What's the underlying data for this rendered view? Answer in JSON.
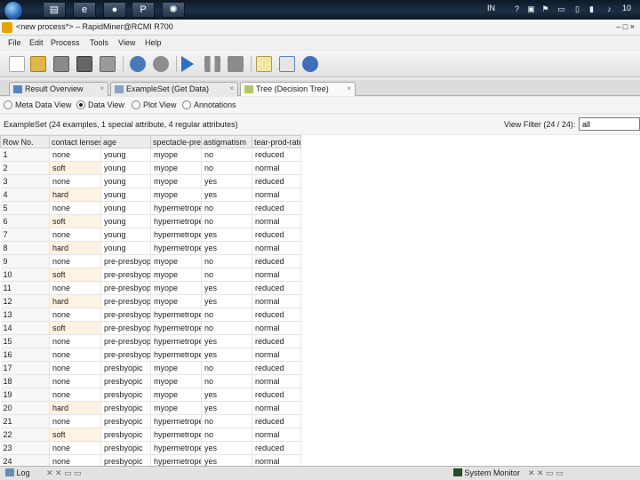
{
  "taskbar": {
    "tray": {
      "language": "IN",
      "time": "10"
    }
  },
  "window": {
    "title": "<new process*> – RapidMiner@RCMI R700",
    "controls": "– □ ×"
  },
  "menu": [
    "File",
    "Edit",
    "Process",
    "Tools",
    "View",
    "Help"
  ],
  "tabs": [
    {
      "label": "Result Overview",
      "close": "×"
    },
    {
      "label": "ExampleSet (Get Data)",
      "close": "×"
    },
    {
      "label": "Tree (Decision Tree)",
      "close": "×"
    }
  ],
  "views": [
    {
      "label": "Meta Data View",
      "selected": false
    },
    {
      "label": "Data View",
      "selected": true
    },
    {
      "label": "Plot View",
      "selected": false
    },
    {
      "label": "Annotations",
      "selected": false
    }
  ],
  "summary": "ExampleSet (24 examples, 1 special attribute, 4 regular attributes)",
  "filter": {
    "label": "View Filter (24 / 24):",
    "value": "all"
  },
  "table": {
    "columns": [
      "Row No.",
      "contact lenses",
      "age",
      "spectacle-prescrip",
      "astigmatism",
      "tear-prod-rate"
    ],
    "rows": [
      [
        "1",
        "none",
        "young",
        "myope",
        "no",
        "reduced"
      ],
      [
        "2",
        "soft",
        "young",
        "myope",
        "no",
        "normal"
      ],
      [
        "3",
        "none",
        "young",
        "myope",
        "yes",
        "reduced"
      ],
      [
        "4",
        "hard",
        "young",
        "myope",
        "yes",
        "normal"
      ],
      [
        "5",
        "none",
        "young",
        "hypermetrope",
        "no",
        "reduced"
      ],
      [
        "6",
        "soft",
        "young",
        "hypermetrope",
        "no",
        "normal"
      ],
      [
        "7",
        "none",
        "young",
        "hypermetrope",
        "yes",
        "reduced"
      ],
      [
        "8",
        "hard",
        "young",
        "hypermetrope",
        "yes",
        "normal"
      ],
      [
        "9",
        "none",
        "pre-presbyopic",
        "myope",
        "no",
        "reduced"
      ],
      [
        "10",
        "soft",
        "pre-presbyopic",
        "myope",
        "no",
        "normal"
      ],
      [
        "11",
        "none",
        "pre-presbyopic",
        "myope",
        "yes",
        "reduced"
      ],
      [
        "12",
        "hard",
        "pre-presbyopic",
        "myope",
        "yes",
        "normal"
      ],
      [
        "13",
        "none",
        "pre-presbyopic",
        "hypermetrope",
        "no",
        "reduced"
      ],
      [
        "14",
        "soft",
        "pre-presbyopic",
        "hypermetrope",
        "no",
        "normal"
      ],
      [
        "15",
        "none",
        "pre-presbyopic",
        "hypermetrope",
        "yes",
        "reduced"
      ],
      [
        "16",
        "none",
        "pre-presbyopic",
        "hypermetrope",
        "yes",
        "normal"
      ],
      [
        "17",
        "none",
        "presbyopic",
        "myope",
        "no",
        "reduced"
      ],
      [
        "18",
        "none",
        "presbyopic",
        "myope",
        "no",
        "normal"
      ],
      [
        "19",
        "none",
        "presbyopic",
        "myope",
        "yes",
        "reduced"
      ],
      [
        "20",
        "hard",
        "presbyopic",
        "myope",
        "yes",
        "normal"
      ],
      [
        "21",
        "none",
        "presbyopic",
        "hypermetrope",
        "no",
        "reduced"
      ],
      [
        "22",
        "soft",
        "presbyopic",
        "hypermetrope",
        "no",
        "normal"
      ],
      [
        "23",
        "none",
        "presbyopic",
        "hypermetrope",
        "yes",
        "reduced"
      ],
      [
        "24",
        "none",
        "presbyopic",
        "hypermetrope",
        "yes",
        "normal"
      ]
    ]
  },
  "statusbar": {
    "log_tab": "Log",
    "system_monitor_tab": "System Monitor"
  },
  "colors": {
    "label_cell": "#fdf3e2",
    "taskbar": "#1d3047",
    "header": "#ececec"
  }
}
